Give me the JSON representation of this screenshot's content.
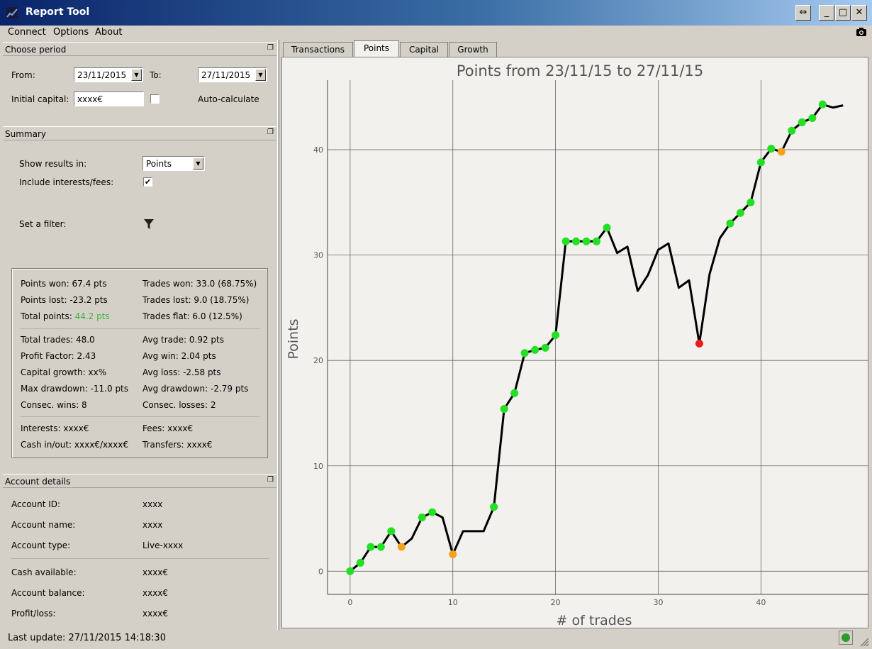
{
  "window": {
    "title": "Report Tool"
  },
  "menu": [
    "Connect",
    "Options",
    "About"
  ],
  "choose_period": {
    "header": "Choose period",
    "from_label": "From:",
    "from_value": "23/11/2015",
    "to_label": "To:",
    "to_value": "27/11/2015",
    "initial_capital_label": "Initial capital:",
    "initial_capital_value": "xxxx€",
    "auto_calculate_label": "Auto-calculate"
  },
  "summary": {
    "header": "Summary",
    "show_results_label": "Show results in:",
    "show_results_value": "Points",
    "include_fees_label": "Include interests/fees:",
    "filter_label": "Set a filter:",
    "stats": {
      "points_won": "Points won: 67.4 pts",
      "trades_won": "Trades won: 33.0 (68.75%)",
      "points_lost": "Points lost: -23.2 pts",
      "trades_lost": "Trades lost: 9.0 (18.75%)",
      "total_points_label": "Total points:",
      "total_points_value": "44.2 pts",
      "trades_flat": "Trades flat: 6.0 (12.5%)",
      "total_trades": "Total trades: 48.0",
      "avg_trade": "Avg trade: 0.92 pts",
      "profit_factor": "Profit Factor: 2.43",
      "avg_win": "Avg win: 2.04 pts",
      "capital_growth": "Capital growth: xx%",
      "avg_loss": "Avg loss: -2.58 pts",
      "max_drawdown": "Max drawdown: -11.0 pts",
      "avg_drawdown": "Avg drawdown: -2.79 pts",
      "consec_wins": "Consec. wins: 8",
      "consec_losses": "Consec. losses: 2",
      "interests": "Interests: xxxx€",
      "fees": "Fees: xxxx€",
      "cash_in_out": "Cash in/out: xxxx€/xxxx€",
      "transfers": "Transfers: xxxx€"
    }
  },
  "account": {
    "header": "Account details",
    "rows": [
      {
        "label": "Account ID:",
        "value": "xxxx"
      },
      {
        "label": "Account name:",
        "value": "xxxx"
      },
      {
        "label": "Account type:",
        "value": "Live-xxxx"
      },
      {
        "label": "Cash available:",
        "value": "xxxx€"
      },
      {
        "label": "Account balance:",
        "value": "xxxx€"
      },
      {
        "label": "Profit/loss:",
        "value": "xxxx€"
      }
    ]
  },
  "tabs": [
    "Transactions",
    "Points",
    "Capital",
    "Growth"
  ],
  "status": {
    "last_update": "Last update: 27/11/2015 14:18:30"
  },
  "colors": {
    "win": "#22e022",
    "loss": "#ee1c1c",
    "flat": "#f7a21b",
    "line": "#000000",
    "status_ok": "#2a9d2a"
  },
  "chart_data": {
    "type": "line",
    "title": "Points from 23/11/15 to 27/11/15",
    "xlabel": "# of trades",
    "ylabel": "Points",
    "xlim": [
      -2.2,
      50.4
    ],
    "ylim": [
      -2.2,
      46.6
    ],
    "xticks": [
      0,
      10,
      20,
      30,
      40
    ],
    "yticks": [
      0,
      10,
      20,
      30,
      40
    ],
    "grid": true,
    "x": [
      0,
      1,
      2,
      3,
      4,
      5,
      6,
      7,
      8,
      9,
      10,
      11,
      12,
      13,
      14,
      15,
      16,
      17,
      18,
      19,
      20,
      21,
      22,
      23,
      24,
      25,
      26,
      27,
      28,
      29,
      30,
      31,
      32,
      33,
      34,
      35,
      36,
      37,
      38,
      39,
      40,
      41,
      42,
      43,
      44,
      45,
      46,
      47,
      48
    ],
    "values": [
      0,
      0.8,
      2.3,
      2.3,
      3.8,
      2.3,
      3.1,
      5.1,
      5.6,
      5.1,
      1.6,
      3.8,
      3.8,
      3.8,
      6.1,
      15.4,
      16.9,
      20.7,
      21.0,
      21.2,
      22.4,
      31.3,
      31.3,
      31.3,
      31.3,
      32.6,
      30.2,
      30.8,
      26.6,
      28.1,
      30.5,
      31.1,
      26.9,
      27.6,
      21.6,
      28.2,
      31.6,
      33.0,
      34.0,
      35.0,
      38.8,
      40.1,
      39.8,
      41.8,
      42.6,
      43.0,
      44.3,
      44.0,
      44.2
    ],
    "markers": [
      "win",
      "win",
      "win",
      "win",
      "win",
      "flat",
      "none",
      "win",
      "win",
      "none",
      "flat",
      "none",
      "none",
      "none",
      "win",
      "win",
      "win",
      "win",
      "win",
      "win",
      "win",
      "win",
      "win",
      "win",
      "win",
      "win",
      "none",
      "none",
      "none",
      "none",
      "none",
      "none",
      "none",
      "none",
      "loss",
      "none",
      "none",
      "win",
      "win",
      "win",
      "win",
      "win",
      "flat",
      "win",
      "win",
      "win",
      "win",
      "none",
      "none"
    ]
  }
}
